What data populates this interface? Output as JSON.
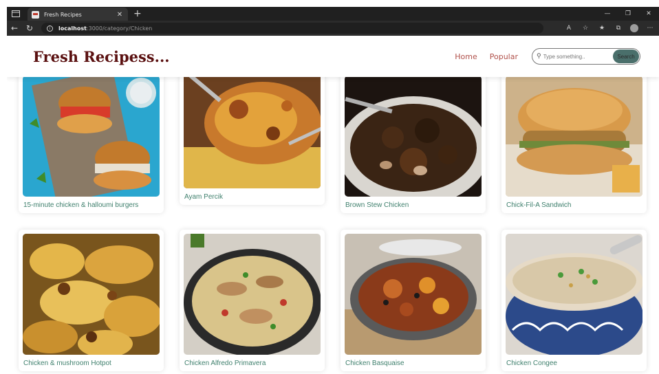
{
  "browser": {
    "tab_title": "Fresh Recipes",
    "url_host": "localhost",
    "url_path": ":3000/category/Chicken"
  },
  "header": {
    "brand": "Fresh Recipess...",
    "nav": [
      "Home",
      "Popular"
    ],
    "search_placeholder": "Type something..",
    "search_button": "Search"
  },
  "recipes": [
    "15-minute chicken & halloumi burgers",
    "Ayam Percik",
    "Brown Stew Chicken",
    "Chick-Fil-A Sandwich",
    "Chicken & mushroom Hotpot",
    "Chicken Alfredo Primavera",
    "Chicken Basquaise",
    "Chicken Congee"
  ],
  "colors": {
    "brand": "#5a1010",
    "nav": "#b0504a",
    "label": "#3e7f6c",
    "search_button": "#4a6f6b"
  }
}
